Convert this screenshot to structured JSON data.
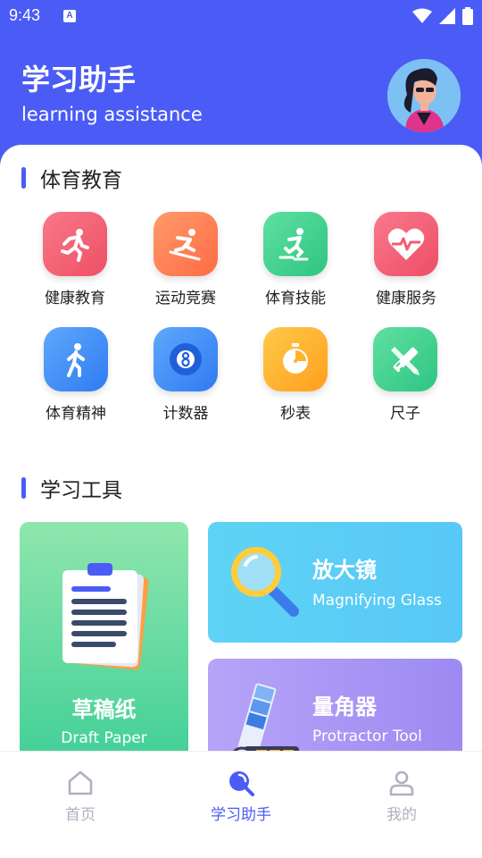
{
  "status_bar": {
    "time": "9:43",
    "notification_letter": "A"
  },
  "header": {
    "title": "学习助手",
    "subtitle": "learning assistance"
  },
  "sections": {
    "sports": {
      "title": "体育教育",
      "items": [
        {
          "label": "健康教育",
          "icon": "running-person-icon",
          "color": "#f0586e"
        },
        {
          "label": "运动竞赛",
          "icon": "skiing-icon",
          "color": "#ff7a50"
        },
        {
          "label": "体育技能",
          "icon": "skating-icon",
          "color": "#3fd08d"
        },
        {
          "label": "健康服务",
          "icon": "heart-rate-icon",
          "color": "#f25a72"
        },
        {
          "label": "体育精神",
          "icon": "walking-person-icon",
          "color": "#3b8cf5"
        },
        {
          "label": "计数器",
          "icon": "eight-ball-icon",
          "color": "#3b8cf5"
        },
        {
          "label": "秒表",
          "icon": "stopwatch-icon",
          "color": "#ffb32c"
        },
        {
          "label": "尺子",
          "icon": "ruler-pencil-icon",
          "color": "#3fd08d"
        }
      ]
    },
    "tools": {
      "title": "学习工具",
      "cards": {
        "draft": {
          "title": "草稿纸",
          "subtitle": "Draft Paper",
          "icon": "clipboard-icon"
        },
        "magnifier": {
          "title": "放大镜",
          "subtitle": "Magnifying Glass",
          "icon": "magnifying-glass-icon"
        },
        "protractor": {
          "title": "量角器",
          "subtitle": "Protractor Tool",
          "icon": "color-swatch-icon"
        }
      }
    }
  },
  "tabbar": {
    "tabs": [
      {
        "label": "首页",
        "icon": "home-icon",
        "active": false
      },
      {
        "label": "学习助手",
        "icon": "search-icon",
        "active": true
      },
      {
        "label": "我的",
        "icon": "user-icon",
        "active": false
      }
    ]
  },
  "colors": {
    "accent": "#4a5cf5",
    "inactive": "#b0b0c0"
  }
}
